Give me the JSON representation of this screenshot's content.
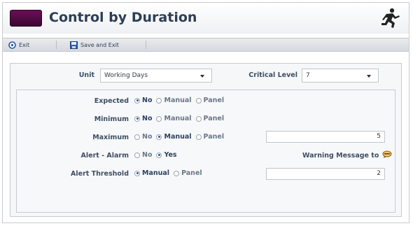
{
  "window": {
    "title": "Control by Duration",
    "brand_color": "#5a0c4c",
    "logo_icon": "running-figure-icon"
  },
  "toolbar": {
    "exit_label": "Exit",
    "exit_icon": "exit-circle-icon",
    "save_exit_label": "Save and Exit",
    "save_exit_icon": "save-disk-icon"
  },
  "settings": {
    "unit_label": "Unit",
    "unit_value": "Working Days",
    "critical_level_label": "Critical Level",
    "critical_level_value": "7"
  },
  "rows": {
    "expected": {
      "label": "Expected",
      "options": [
        "No",
        "Manual",
        "Panel"
      ],
      "selected": "No"
    },
    "minimum": {
      "label": "Minimum",
      "options": [
        "No",
        "Manual",
        "Panel"
      ],
      "selected": "No"
    },
    "maximum": {
      "label": "Maximum",
      "options": [
        "No",
        "Manual",
        "Panel"
      ],
      "selected": "Manual",
      "value": "5"
    },
    "alert_alarm": {
      "label": "Alert - Alarm",
      "options": [
        "No",
        "Yes"
      ],
      "selected": "Yes",
      "warning_label": "Warning Message to",
      "warning_icon": "message-bubble-icon"
    },
    "alert_threshold": {
      "label": "Alert Threshold",
      "options": [
        "Manual",
        "Panel"
      ],
      "selected": "Manual",
      "value": "2"
    }
  }
}
